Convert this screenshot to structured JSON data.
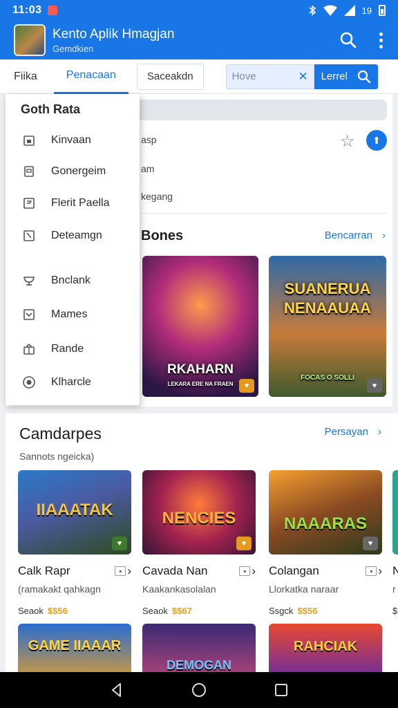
{
  "status": {
    "time": "11:03",
    "right_text": "19"
  },
  "appbar": {
    "title": "Kento Aplik Hmagjan",
    "subtitle": "Gemdkien"
  },
  "tabs": {
    "first": "Fiika",
    "active": "Penacaan",
    "boxed": "Saceakdn"
  },
  "search": {
    "placeholder": "Hove",
    "button_label": "Lerrel"
  },
  "drawer": {
    "title": "Goth Rata",
    "items": [
      {
        "label": "Kinvaan",
        "icon": "calendar-icon"
      },
      {
        "label": "Gonergeim",
        "icon": "document-icon"
      },
      {
        "label": "Flerit Paella",
        "icon": "flag-icon"
      },
      {
        "label": "Deteamgn",
        "icon": "edit-icon"
      },
      {
        "label": "Bnclank",
        "icon": "trophy-icon"
      },
      {
        "label": "Mames",
        "icon": "check-box-icon"
      },
      {
        "label": "Rande",
        "icon": "gift-icon"
      },
      {
        "label": "Klharcle",
        "icon": "record-icon"
      }
    ]
  },
  "peek": {
    "line1": "asp",
    "line2": "am",
    "line3": "kegang"
  },
  "featured": {
    "title": "Bones",
    "see_all": "Bencarran",
    "tiles": [
      {
        "title": "RKAHARN",
        "tag": "LEKARA ERE NA FRAEN"
      },
      {
        "title": "SUANERUA NENAAUAA",
        "tag": "FOCAS O SOLLI"
      }
    ]
  },
  "games": {
    "title": "Camdarpes",
    "see_all": "Persayan",
    "subtitle": "Sannots ngeicka)",
    "items": [
      {
        "art_title": "IIAAATAK",
        "name": "Calk Rapr",
        "developer": "(ramakakt qahkagn",
        "price_label": "Seaok",
        "price": "$$56"
      },
      {
        "art_title": "NENCIES",
        "name": "Cavada Nan",
        "developer": "Kaakankasolalan",
        "price_label": "Seaok",
        "price": "$$67"
      },
      {
        "art_title": "NAAARAS",
        "name": "Colangan",
        "developer": "Llorkatka naraar",
        "price_label": "Ssgck",
        "price": "$$56"
      },
      {
        "art_title": "",
        "name": "N",
        "developer": "r",
        "price_label": "$",
        "price": ""
      }
    ],
    "row2_titles": [
      "GAME IIAAAR",
      "DEMOGAN",
      "RAHCIAK"
    ]
  },
  "colors": {
    "primary": "#1976e6",
    "price": "#e8a11a",
    "notification": "#ff5a4d"
  }
}
